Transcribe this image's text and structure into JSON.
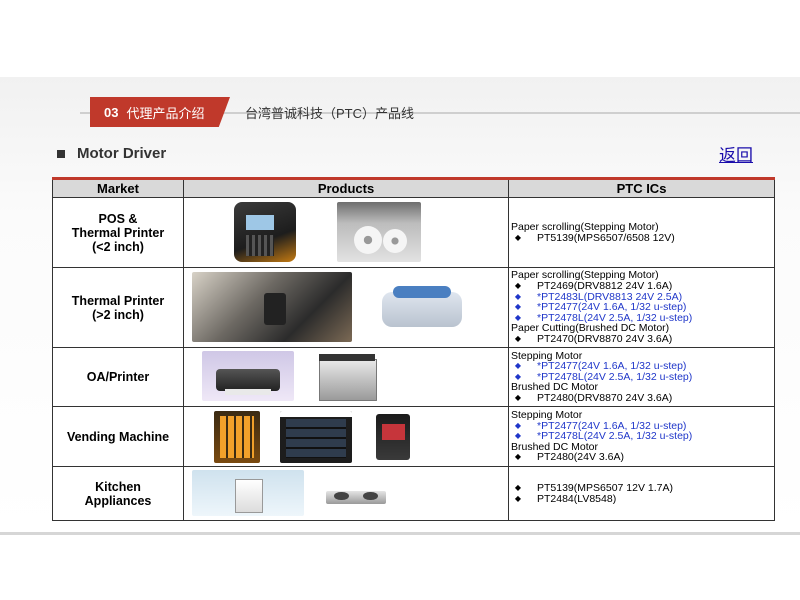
{
  "header": {
    "badge_number": "03",
    "badge_label": "代理产品介绍",
    "subtitle": "台湾普诚科技（PTC）产品线"
  },
  "section": {
    "title": "Motor Driver"
  },
  "back_link": "返回",
  "table": {
    "headers": [
      "Market",
      "Products",
      "PTC ICs"
    ],
    "rows": [
      {
        "market": [
          "POS &",
          "Thermal Printer",
          "(<2 inch)"
        ],
        "ics": [
          {
            "text": "Paper scrolling(Stepping Motor)",
            "type": "head"
          },
          {
            "text": "PT5139(MPS6507/6508 12V)",
            "type": "black"
          }
        ]
      },
      {
        "market": [
          "Thermal Printer",
          "(>2 inch)"
        ],
        "ics": [
          {
            "text": "Paper scrolling(Stepping Motor)",
            "type": "head"
          },
          {
            "text": "PT2469(DRV8812 24V 1.6A)",
            "type": "black"
          },
          {
            "text": "*PT2483L(DRV8813 24V 2.5A)",
            "type": "blue"
          },
          {
            "text": "*PT2477(24V 1.6A, 1/32 u-step)",
            "type": "blue"
          },
          {
            "text": "*PT2478L(24V 2.5A, 1/32 u-step)",
            "type": "blue"
          },
          {
            "text": "Paper Cutting(Brushed DC Motor)",
            "type": "head"
          },
          {
            "text": "PT2470(DRV8870 24V 3.6A)",
            "type": "black"
          }
        ]
      },
      {
        "market": [
          "OA/Printer"
        ],
        "ics": [
          {
            "text": "Stepping Motor",
            "type": "head"
          },
          {
            "text": "*PT2477(24V 1.6A, 1/32 u-step)",
            "type": "blue"
          },
          {
            "text": "*PT2478L(24V 2.5A, 1/32 u-step)",
            "type": "blue"
          },
          {
            "text": "Brushed DC Motor",
            "type": "head"
          },
          {
            "text": "PT2480(DRV8870 24V 3.6A)",
            "type": "black"
          }
        ]
      },
      {
        "market": [
          "Vending Machine"
        ],
        "ics": [
          {
            "text": "Stepping Motor",
            "type": "head"
          },
          {
            "text": "*PT2477(24V 1.6A, 1/32 u-step)",
            "type": "blue"
          },
          {
            "text": "*PT2478L(24V 2.5A, 1/32 u-step)",
            "type": "blue"
          },
          {
            "text": "Brushed DC Motor",
            "type": "head"
          },
          {
            "text": "PT2480(24V 3.6A)",
            "type": "black"
          }
        ]
      },
      {
        "market": [
          "Kitchen",
          "Appliances"
        ],
        "ics": [
          {
            "text": "PT5139(MPS6507 12V 1.7A)",
            "type": "black"
          },
          {
            "text": "PT2484(LV8548)",
            "type": "black"
          }
        ]
      }
    ]
  },
  "colors": {
    "accent": "#c0392b",
    "ic_blue": "#1f36c9",
    "ic_black": "#000000"
  },
  "icons": {
    "bullet": "diamond-bullet-icon",
    "section": "square-bullet-icon"
  }
}
